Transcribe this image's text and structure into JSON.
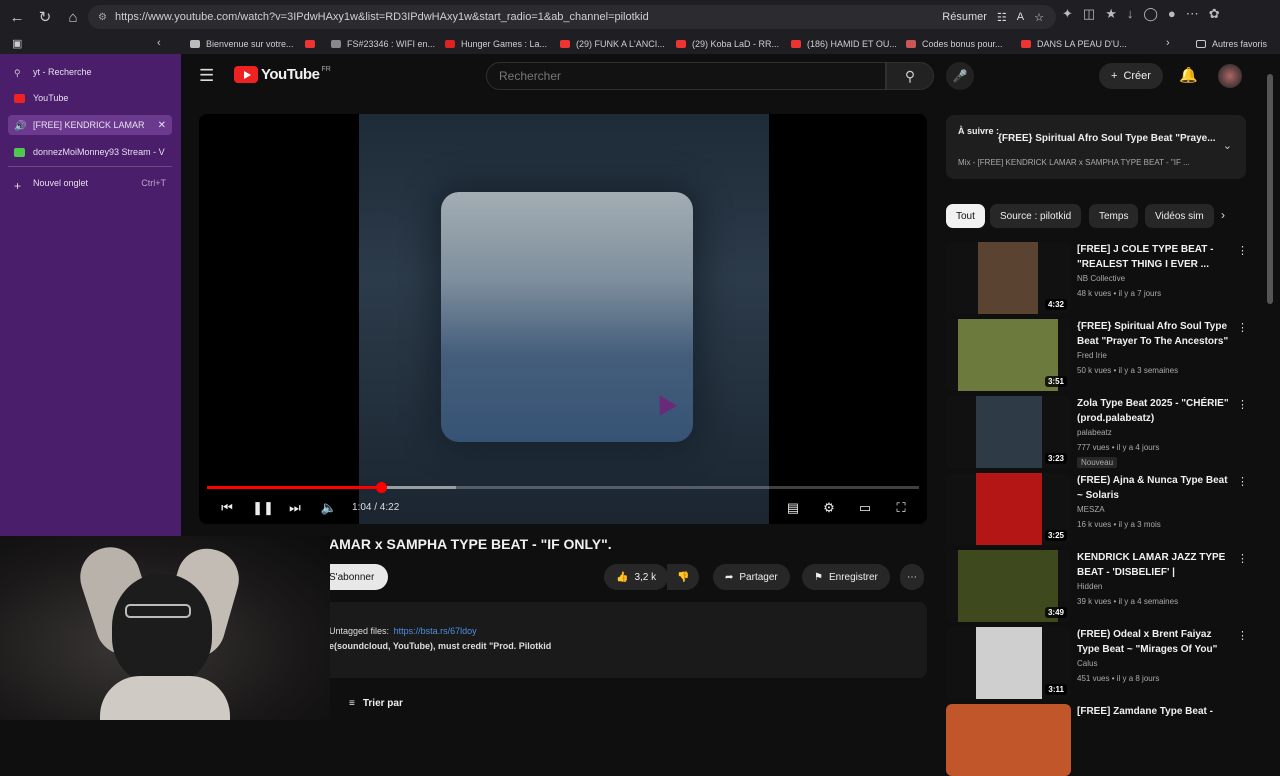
{
  "browser": {
    "url": "https://www.youtube.com/watch?v=3IPdwHAxy1w&list=RD3IPdwHAxy1w&start_radio=1&ab_channel=pilotkid",
    "resume_label": "Résumer",
    "bookmarks": [
      {
        "label": "Bienvenue sur votre..."
      },
      {
        "label": ""
      },
      {
        "label": "FS#23346 : WIFI en..."
      },
      {
        "label": "Hunger Games : La..."
      },
      {
        "label": "(29) FUNK A L'ANCI..."
      },
      {
        "label": "(29) Koba LaD - RR..."
      },
      {
        "label": "(186) HAMID ET OU..."
      },
      {
        "label": "Codes bonus pour..."
      },
      {
        "label": "DANS LA PEAU D'U..."
      }
    ],
    "other_bookmarks": "Autres favoris",
    "sidebar_tabs": [
      {
        "label": "yt - Recherche"
      },
      {
        "label": "YouTube"
      },
      {
        "label": "[FREE] KENDRICK LAMAR"
      },
      {
        "label": "donnezMoiMonney93 Stream - V"
      }
    ],
    "new_tab": {
      "label": "Nouvel onglet",
      "shortcut": "Ctrl+T"
    }
  },
  "youtube": {
    "logo": "YouTube",
    "country": "FR",
    "search_placeholder": "Rechercher",
    "create_label": "Créer",
    "player": {
      "current_time": "1:04",
      "duration": "4:22",
      "time_display": "1:04 / 4:22",
      "progress_fraction": 0.2443,
      "buffered_fraction": 0.35
    },
    "title": "AMAR x SAMPHA TYPE BEAT - \"IF ONLY\".",
    "subscribe_label": "S'abonner",
    "likes": "3,2 k",
    "share_label": "Partager",
    "save_label": "Enregistrer",
    "description": {
      "untagged_label": "Untagged files:",
      "untagged_link": "https://bsta.rs/67ldoy",
      "credit_line": "e(soundcloud, YouTube), must credit \"Prod. Pilotkid"
    },
    "sort_label": "Trier par",
    "up_next": {
      "label": "À suivre :",
      "title": "{FREE} Spiritual Afro Soul Type Beat \"Praye...",
      "subtitle": "Mix - [FREE] KENDRICK LAMAR x SAMPHA TYPE BEAT - \"IF ..."
    },
    "chips": [
      {
        "label": "Tout"
      },
      {
        "label": "Source : pilotkid"
      },
      {
        "label": "Temps"
      },
      {
        "label": "Vidéos sim"
      }
    ],
    "recommendations": [
      {
        "title": "[FREE] J COLE TYPE BEAT - \"REALEST THING I EVER ...",
        "channel": "NB Collective",
        "meta": "48 k vues • il y a 7 jours",
        "duration": "4:32",
        "badge": "",
        "thumb_color": "#5a4330"
      },
      {
        "title": "{FREE} Spiritual Afro Soul Type Beat \"Prayer To The Ancestors\"",
        "channel": "Fred Irie",
        "meta": "50 k vues • il y a 3 semaines",
        "duration": "3:51",
        "badge": "",
        "thumb_color": "#6d7a3e"
      },
      {
        "title": "Zola Type Beat 2025 - \"CHÉRIE\" (prod.palabeatz)",
        "channel": "palabeatz",
        "meta": "777 vues • il y a 4 jours",
        "duration": "3:23",
        "badge": "Nouveau",
        "thumb_color": "#2e3b46"
      },
      {
        "title": "(FREE) Ajna & Nunca Type Beat ~ Solaris",
        "channel": "MESZA",
        "meta": "16 k vues • il y a 3 mois",
        "duration": "3:25",
        "badge": "",
        "thumb_color": "#b41515"
      },
      {
        "title": "KENDRICK LAMAR JAZZ TYPE BEAT - 'DISBELIEF' | UNTITLED...",
        "channel": "Hidden",
        "meta": "39 k vues • il y a 4 semaines",
        "duration": "3:49",
        "badge": "",
        "thumb_color": "#3e4a1e"
      },
      {
        "title": "(FREE) Odeal x Brent Faiyaz Type Beat ~ \"Mirages Of You\"",
        "channel": "Calus",
        "meta": "451 vues • il y a 8 jours",
        "duration": "3:11",
        "badge": "",
        "thumb_color": "#cfcfcf"
      },
      {
        "title": "[FREE] Zamdane Type Beat -",
        "channel": "",
        "meta": "",
        "duration": "",
        "badge": "",
        "thumb_color": "#c0562a"
      }
    ]
  }
}
